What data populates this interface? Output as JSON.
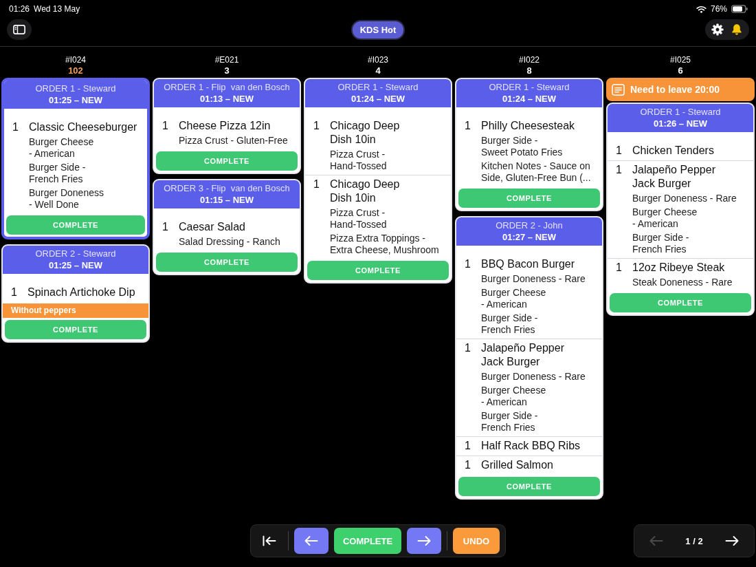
{
  "status_bar": {
    "time": "01:26",
    "date": "Wed 13 May",
    "battery": "76%"
  },
  "header": {
    "station": "KDS Hot"
  },
  "columns": [
    {
      "ticket": "#I024",
      "count": "102",
      "color": "#f2a052",
      "cards": [
        {
          "title": "ORDER 1 - Steward",
          "time": "01:25 – NEW",
          "selected": true,
          "items": [
            {
              "qty": "1",
              "name": "Classic Cheeseburger",
              "modifiers": [
                "Burger Cheese - American",
                "Burger Side - French Fries",
                "Burger Doneness - Well Done"
              ]
            }
          ],
          "button": "COMPLETE"
        },
        {
          "title": "ORDER 2 - Steward",
          "time": "01:25 – NEW",
          "selected": false,
          "items": [
            {
              "qty": "1",
              "name": "Spinach Artichoke Dip"
            }
          ],
          "note": "Without peppers",
          "button": "COMPLETE"
        }
      ]
    },
    {
      "ticket": "#E021",
      "count": "3",
      "color": "#ffffff",
      "cards": [
        {
          "title": "ORDER 1 - Flip  van den Bosch",
          "time": "01:13 – NEW",
          "selected": false,
          "items": [
            {
              "qty": "1",
              "name": "Cheese Pizza 12in",
              "modifiers": [
                "Pizza Crust - Gluten-Free"
              ]
            }
          ],
          "button": "COMPLETE"
        },
        {
          "title": "ORDER 3 - Flip  van den Bosch",
          "time": "01:15 – NEW",
          "selected": false,
          "items": [
            {
              "qty": "1",
              "name": "Caesar Salad",
              "modifiers": [
                "Salad Dressing - Ranch"
              ]
            }
          ],
          "button": "COMPLETE"
        }
      ]
    },
    {
      "ticket": "#I023",
      "count": "4",
      "color": "#ffffff",
      "cards": [
        {
          "title": "ORDER 1 - Steward",
          "time": "01:24 – NEW",
          "selected": false,
          "items": [
            {
              "qty": "1",
              "name": "Chicago Deep Dish 10in",
              "modifiers": [
                "Pizza Crust - Hand-Tossed"
              ]
            },
            {
              "qty": "1",
              "name": "Chicago Deep Dish 10in",
              "modifiers": [
                "Pizza Crust - Hand-Tossed",
                "Pizza Extra Toppings - Extra Cheese, Mushroom"
              ]
            }
          ],
          "button": "COMPLETE"
        }
      ]
    },
    {
      "ticket": "#I022",
      "count": "8",
      "color": "#ffffff",
      "cards": [
        {
          "title": "ORDER 1 - Steward",
          "time": "01:24 – NEW",
          "selected": false,
          "items": [
            {
              "qty": "1",
              "name": "Philly Cheesesteak",
              "modifiers": [
                "Burger Side - Sweet Potato Fries",
                "Kitchen Notes - Sauce on Side, Gluten-Free Bun (..."
              ]
            }
          ],
          "button": "COMPLETE"
        },
        {
          "title": "ORDER 2 - John",
          "time": "01:27 – NEW",
          "selected": false,
          "items": [
            {
              "qty": "1",
              "name": "BBQ Bacon Burger",
              "modifiers": [
                "Burger Doneness - Rare",
                "Burger Cheese - American",
                "Burger Side - French Fries"
              ]
            },
            {
              "qty": "1",
              "name": "Jalapeño Pepper Jack Burger",
              "modifiers": [
                "Burger Doneness - Rare",
                "Burger Cheese - American",
                "Burger Side - French Fries"
              ]
            },
            {
              "qty": "1",
              "name": "Half Rack BBQ Ribs"
            },
            {
              "qty": "1",
              "name": "Grilled Salmon"
            }
          ],
          "button": "COMPLETE"
        }
      ]
    },
    {
      "ticket": "#I025",
      "count": "6",
      "color": "#ffffff",
      "banner": "Need to leave 20:00",
      "cards": [
        {
          "title": "ORDER 1 - Steward",
          "time": "01:26 – NEW",
          "selected": false,
          "items": [
            {
              "qty": "1",
              "name": "Chicken Tenders"
            },
            {
              "qty": "1",
              "name": "Jalapeño Pepper Jack Burger",
              "modifiers": [
                "Burger Doneness - Rare",
                "Burger Cheese - American",
                "Burger Side - French Fries"
              ]
            },
            {
              "qty": "1",
              "name": "12oz Ribeye Steak",
              "modifiers": [
                "Steak Doneness - Rare"
              ]
            }
          ],
          "button": "COMPLETE"
        }
      ]
    }
  ],
  "action_bar": {
    "actions": [
      {
        "kind": "first"
      },
      {
        "kind": "prev"
      },
      {
        "kind": "complete",
        "label": "COMPLETE"
      },
      {
        "kind": "next"
      },
      {
        "kind": "undo",
        "label": "UNDO"
      }
    ]
  },
  "pager": {
    "label": "1 / 2",
    "prev": {
      "disabled": true
    },
    "next": {
      "disabled": false
    }
  }
}
